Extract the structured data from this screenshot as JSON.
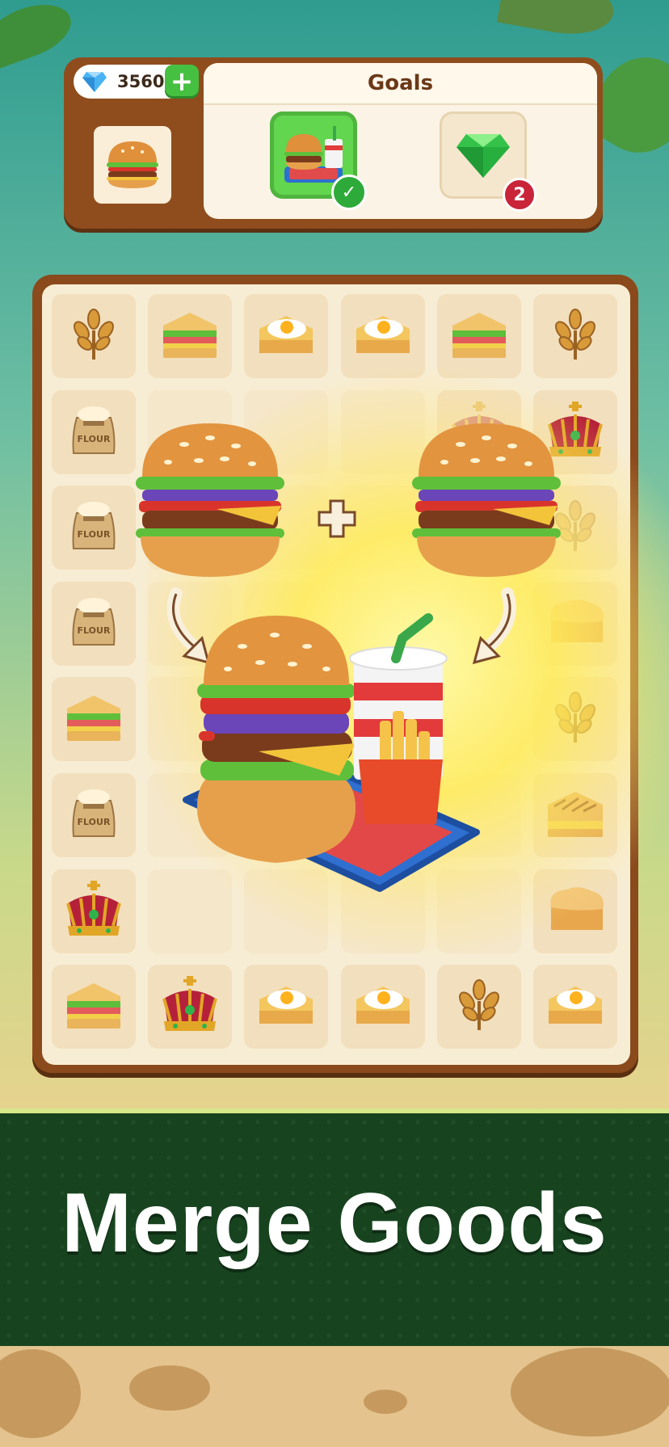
{
  "currency": {
    "icon": "diamond-icon",
    "value": "3560",
    "add_label": "+"
  },
  "current_item": {
    "icon": "burger-icon"
  },
  "goals": {
    "title": "Goals",
    "items": [
      {
        "icon": "burger-meal-icon",
        "status": "completed",
        "badge": "✓"
      },
      {
        "icon": "green-gem-icon",
        "status": "pending",
        "badge": "2"
      }
    ]
  },
  "board": {
    "columns": 6,
    "rows": 8,
    "cells": [
      [
        "wheat",
        "sandwich",
        "egg-toast",
        "egg-toast",
        "sandwich",
        "wheat"
      ],
      [
        "flour-sack",
        "",
        "",
        "",
        "crown-faded",
        "crown"
      ],
      [
        "flour-sack",
        "",
        "",
        "",
        "",
        "wheat-faded"
      ],
      [
        "flour-sack",
        "",
        "",
        "",
        "",
        "bread"
      ],
      [
        "sandwich",
        "",
        "",
        "",
        "",
        "wheat"
      ],
      [
        "flour-sack",
        "",
        "",
        "",
        "",
        "grilled-toast"
      ],
      [
        "crown",
        "",
        "",
        "",
        "",
        "bread"
      ],
      [
        "sandwich",
        "crown",
        "egg-toast",
        "egg-toast",
        "wheat",
        "egg-toast"
      ]
    ]
  },
  "merge_demo": {
    "inputs": [
      "burger-icon",
      "burger-icon"
    ],
    "operator": "+",
    "result": "burger-meal-icon"
  },
  "colors": {
    "wood": "#8b4a1c",
    "board": "#f7edd4",
    "banner": "#17441f",
    "accent_green": "#46c040"
  },
  "banner": {
    "title": "Merge Goods"
  }
}
